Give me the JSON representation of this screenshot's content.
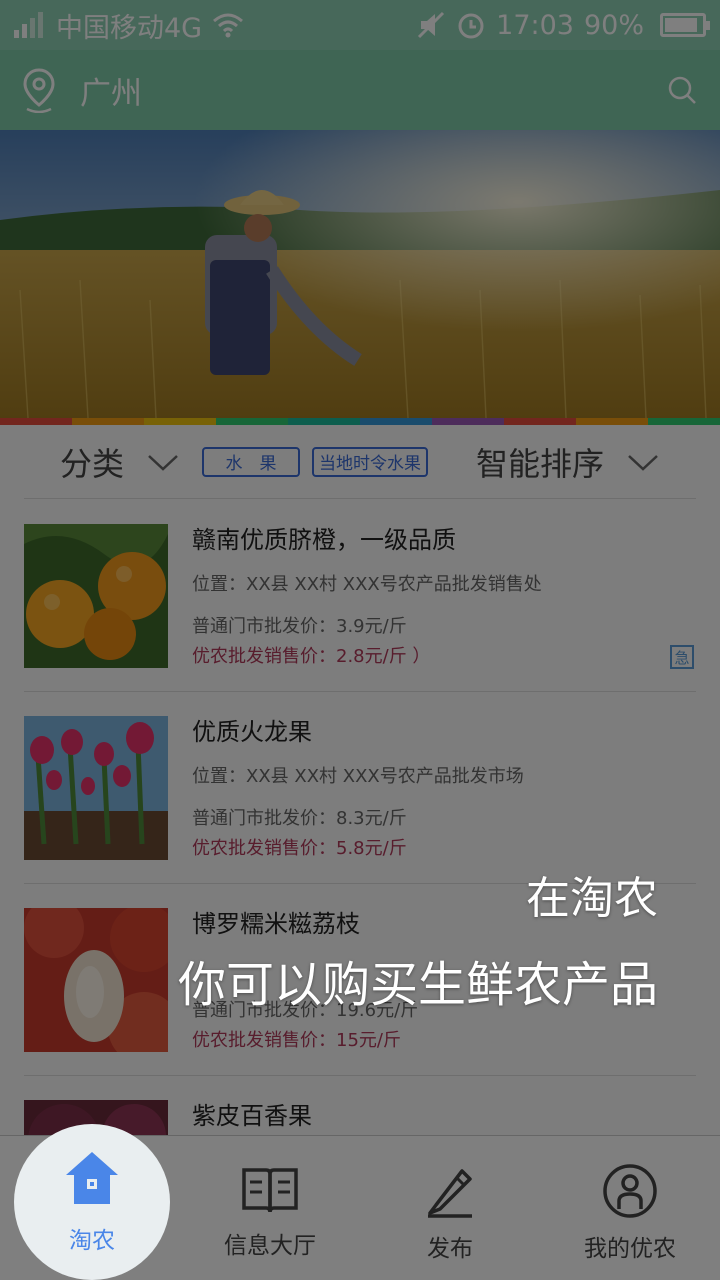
{
  "status_bar": {
    "carrier": "中国移动4G",
    "time": "17:03",
    "battery_percent": "90%",
    "battery_level": 0.9
  },
  "header": {
    "city": "广州",
    "location_icon": "location-pin-icon",
    "search_icon": "search-icon"
  },
  "filter": {
    "category_label": "分类",
    "tags": [
      "水　果",
      "当地时令水果"
    ],
    "sort_label": "智能排序",
    "accent_color": "#3b6bd6"
  },
  "products": [
    {
      "name": "赣南优质脐橙，一级品质",
      "location": "位置：XX县 XX村 XXX号农产品批发销售处",
      "market_price": "普通门市批发价：3.9元/斤",
      "member_price": "优农批发销售价：2.8元/斤 ）",
      "urgent": "急"
    },
    {
      "name": "优质火龙果",
      "location": "位置：XX县 XX村 XXX号农产品批发市场",
      "market_price": "普通门市批发价：8.3元/斤",
      "member_price": "优农批发销售价：5.8元/斤"
    },
    {
      "name": "博罗糯米糍荔枝",
      "location": "",
      "market_price": "普通门市批发价：19.6元/斤",
      "member_price": "优农批发销售价：15元/斤"
    },
    {
      "name": "紫皮百香果"
    }
  ],
  "guide": {
    "line1": "在淘农",
    "line2": "你可以购买生鲜农产品"
  },
  "tabs": [
    {
      "label": "淘农",
      "icon": "house-icon",
      "active": true
    },
    {
      "label": "信息大厅",
      "icon": "book-icon"
    },
    {
      "label": "发布",
      "icon": "pencil-icon"
    },
    {
      "label": "我的优农",
      "icon": "user-icon"
    }
  ]
}
